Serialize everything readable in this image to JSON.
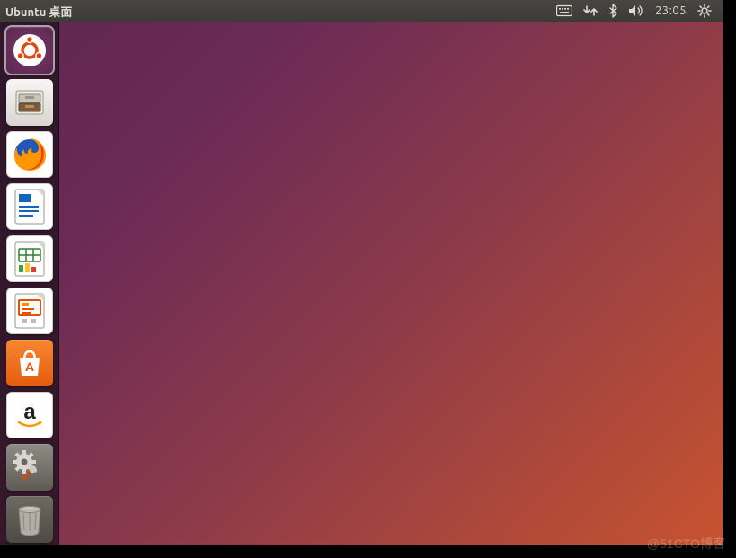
{
  "menubar": {
    "title": "Ubuntu 桌面",
    "clock": "23:05",
    "indicators": {
      "keyboard": "keyboard-icon",
      "network": "network-icon",
      "bluetooth": "bluetooth-icon",
      "volume": "volume-icon",
      "session": "session-cog-icon"
    }
  },
  "launcher": {
    "items": [
      {
        "name": "dash",
        "label": "Dash",
        "bg": "purple",
        "selected": true
      },
      {
        "name": "files",
        "label": "文件",
        "bg": "grey"
      },
      {
        "name": "firefox",
        "label": "Firefox",
        "bg": "white"
      },
      {
        "name": "writer",
        "label": "LibreOffice Writer",
        "bg": "white"
      },
      {
        "name": "calc",
        "label": "LibreOffice Calc",
        "bg": "white"
      },
      {
        "name": "impress",
        "label": "LibreOffice Impress",
        "bg": "white"
      },
      {
        "name": "software",
        "label": "Ubuntu 软件",
        "bg": "orange"
      },
      {
        "name": "amazon",
        "label": "Amazon",
        "bg": "white"
      },
      {
        "name": "settings",
        "label": "系统设置",
        "bg": "dark"
      },
      {
        "name": "trash",
        "label": "回收站",
        "bg": "trash"
      }
    ]
  },
  "watermark": "@51CTO博客",
  "colors": {
    "accent": "#e95420",
    "panel": "#3c3b37"
  }
}
